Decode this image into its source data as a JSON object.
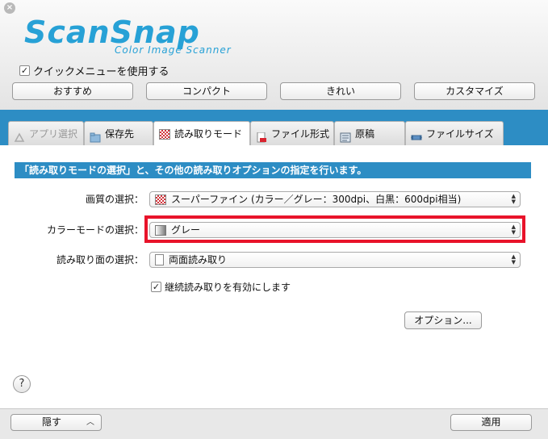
{
  "window": {
    "close_icon": "close-circle-icon"
  },
  "logo": {
    "main": "ScanSnap",
    "sub": "Color Image Scanner",
    "color": "#27a1d6"
  },
  "quick_menu": {
    "label": "クイックメニューを使用する",
    "checked": true
  },
  "presets": [
    "おすすめ",
    "コンパクト",
    "きれい",
    "カスタマイズ"
  ],
  "tabs": [
    {
      "label": "アプリ選択",
      "icon": "app-select-icon",
      "state": "disabled"
    },
    {
      "label": "保存先",
      "icon": "folder-icon",
      "state": "normal"
    },
    {
      "label": "読み取りモード",
      "icon": "checker-icon",
      "state": "active"
    },
    {
      "label": "ファイル形式",
      "icon": "file-format-icon",
      "state": "normal"
    },
    {
      "label": "原稿",
      "icon": "document-icon",
      "state": "normal"
    },
    {
      "label": "ファイルサイズ",
      "icon": "file-size-icon",
      "state": "normal"
    }
  ],
  "description": "「読み取りモードの選択」と、その他の読み取りオプションの指定を行います。",
  "settings": {
    "quality": {
      "label": "画質の選択：",
      "value": "スーパーファイン (カラー／グレー：300dpi、白黒：600dpi相当)"
    },
    "color_mode": {
      "label": "カラーモードの選択：",
      "value": "グレー"
    },
    "side": {
      "label": "読み取り面の選択：",
      "value": "両面読み取り"
    }
  },
  "continuous": {
    "label": "継続読み取りを有効にします",
    "checked": true
  },
  "options_button": "オプション...",
  "help": "?",
  "bottom": {
    "hide": "隠す",
    "apply": "適用"
  },
  "colors": {
    "accent": "#2d8dc4",
    "highlight": "#e8132a"
  }
}
